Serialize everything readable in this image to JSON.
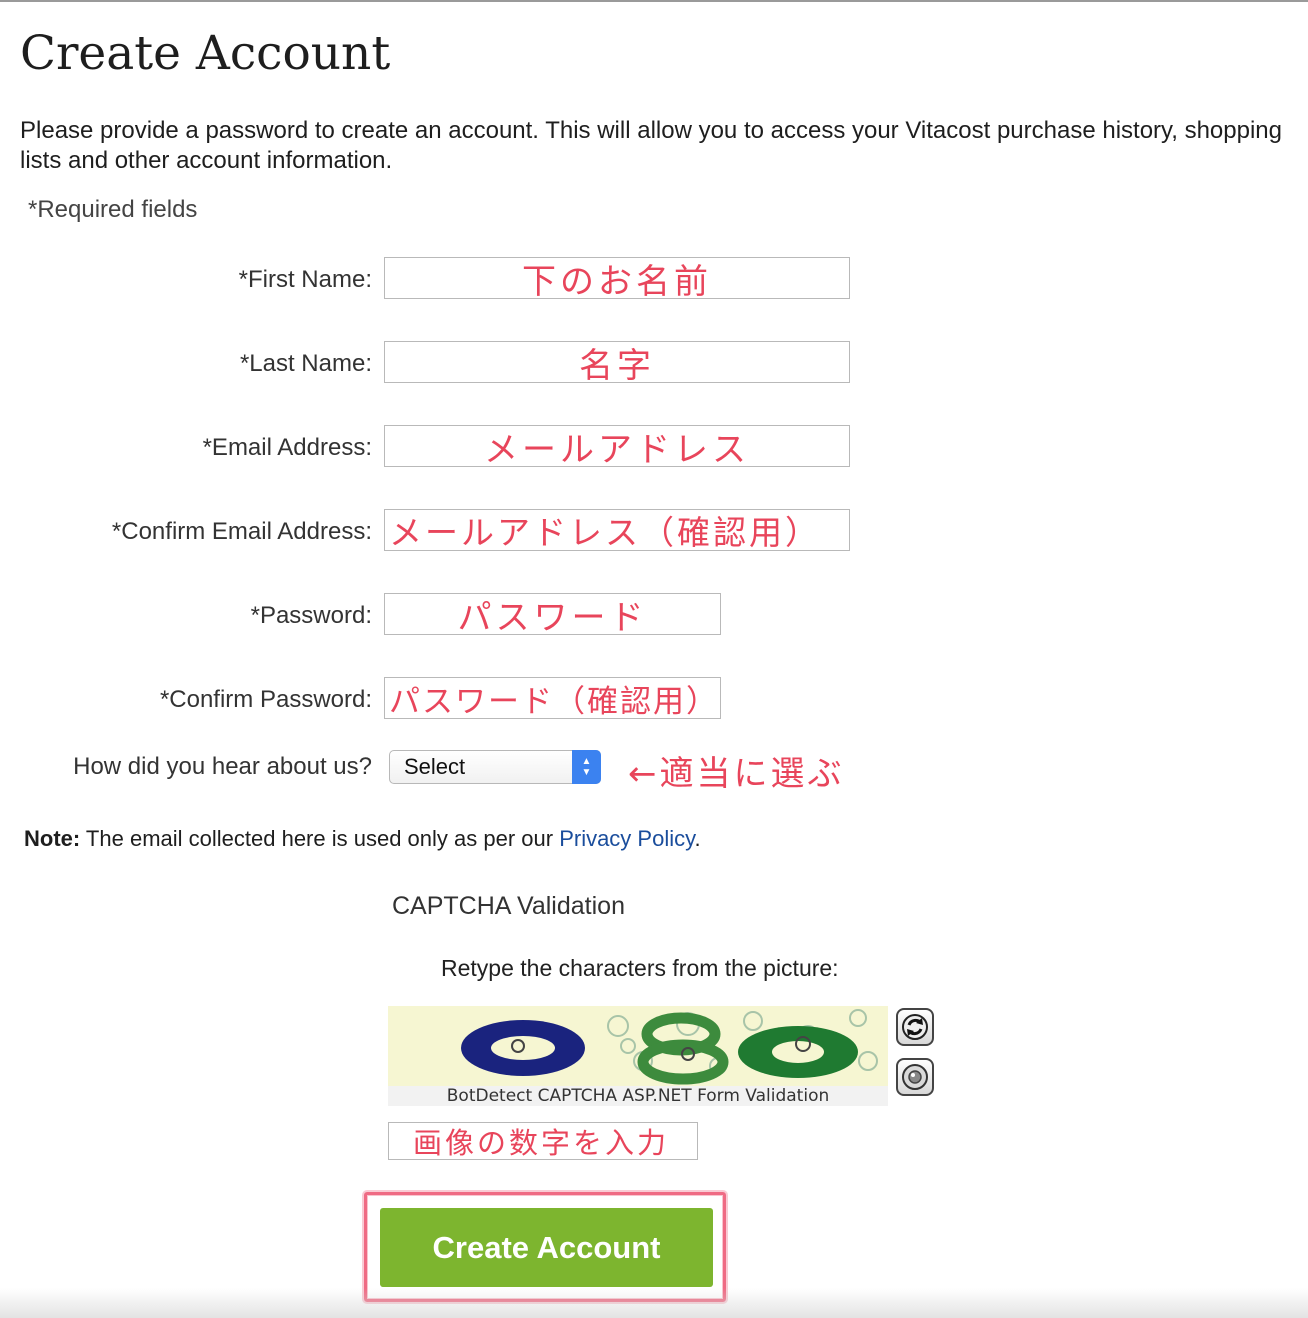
{
  "page": {
    "title": "Create Account",
    "intro": "Please provide a password to create an account. This will allow you to access your Vitacost purchase history, shopping lists and other account information.",
    "required_note": "*Required fields"
  },
  "form": {
    "first_name": {
      "label": "*First Name:",
      "value": "下のお名前"
    },
    "last_name": {
      "label": "*Last Name:",
      "value": "名字"
    },
    "email": {
      "label": "*Email Address:",
      "value": "メールアドレス"
    },
    "confirm_email": {
      "label": "*Confirm Email Address:",
      "value": "メールアドレス（確認用）"
    },
    "password": {
      "label": "*Password:",
      "value": "パスワード"
    },
    "confirm_password": {
      "label": "*Confirm Password:",
      "value": "パスワード（確認用）"
    },
    "hear_about": {
      "label": "How did you hear about us?",
      "selected": "Select",
      "annotation": "←適当に選ぶ"
    }
  },
  "note": {
    "bold": "Note:",
    "text": " The email collected here is used only as per our ",
    "link": "Privacy Policy",
    "end": "."
  },
  "captcha": {
    "title": "CAPTCHA Validation",
    "instruction": "Retype the characters from the picture:",
    "caption": "BotDetect CAPTCHA ASP.NET Form Validation",
    "input_value": "画像の数字を入力"
  },
  "submit": {
    "label": "Create Account"
  },
  "colors": {
    "annotation": "#e8455b",
    "button_green": "#7db52f",
    "link_blue": "#1a4d9c",
    "select_blue": "#3b82f0"
  }
}
